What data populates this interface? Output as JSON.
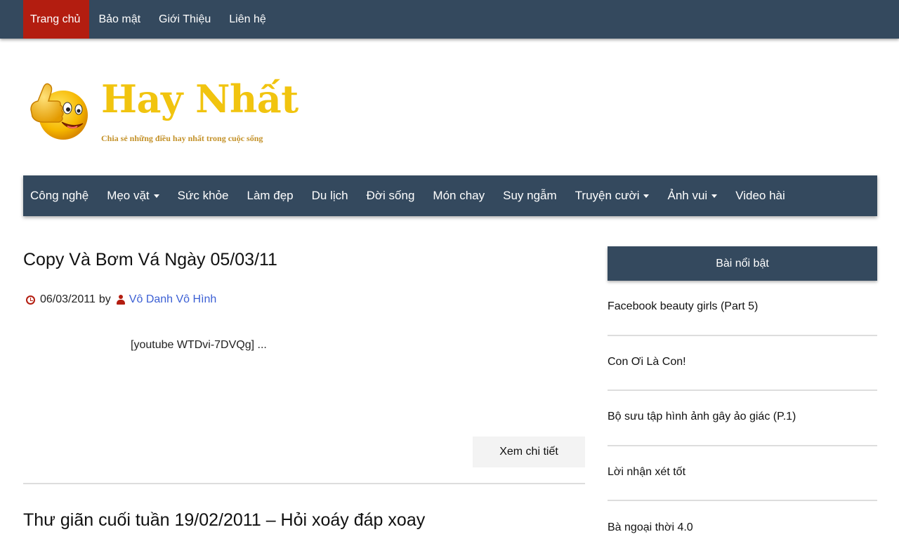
{
  "top_menu": {
    "items": [
      {
        "label": "Trang chủ",
        "active": true
      },
      {
        "label": "Bảo mật",
        "active": false
      },
      {
        "label": "Giới Thiệu",
        "active": false
      },
      {
        "label": "Liên hệ",
        "active": false
      }
    ]
  },
  "logo": {
    "title": "Hay Nhất",
    "tagline": "Chia sẻ những điều hay nhất trong cuộc sống",
    "icon": "thumbs-up-smiley-icon"
  },
  "category_nav": {
    "items": [
      {
        "label": "Công nghệ",
        "dropdown": false
      },
      {
        "label": "Mẹo vặt",
        "dropdown": true
      },
      {
        "label": "Sức khỏe",
        "dropdown": false
      },
      {
        "label": "Làm đẹp",
        "dropdown": false
      },
      {
        "label": "Du lịch",
        "dropdown": false
      },
      {
        "label": "Đời sống",
        "dropdown": false
      },
      {
        "label": "Món chay",
        "dropdown": false
      },
      {
        "label": "Suy ngẫm",
        "dropdown": false
      },
      {
        "label": "Truyện cười",
        "dropdown": true
      },
      {
        "label": "Ảnh vui",
        "dropdown": true
      },
      {
        "label": "Video hài",
        "dropdown": false
      }
    ]
  },
  "posts": [
    {
      "title": "Copy Và Bơm Vá Ngày 05/03/11",
      "date": "06/03/2011",
      "by": "by",
      "author": "Vô Danh Vô Hình",
      "excerpt": "[youtube WTDvi-7DVQg] ...",
      "read_more": "Xem chi tiết"
    },
    {
      "title": "Thư giãn cuối tuần 19/02/2011 – Hỏi xoáy đáp xoay"
    }
  ],
  "sidebar": {
    "widget_title": "Bài nổi bật",
    "items": [
      "Facebook beauty girls (Part 5)",
      "Con Ơi Là Con!",
      "Bộ sưu tập hình ảnh gây ảo giác (P.1)",
      "Lời nhận xét tốt",
      "Bà ngoại thời 4.0"
    ]
  },
  "colors": {
    "nav_bg": "#34495e",
    "active_bg": "#b31d10",
    "logo_yellow": "#f1c40f",
    "link_blue": "#3b5fd4",
    "icon_red": "#b31d10"
  }
}
